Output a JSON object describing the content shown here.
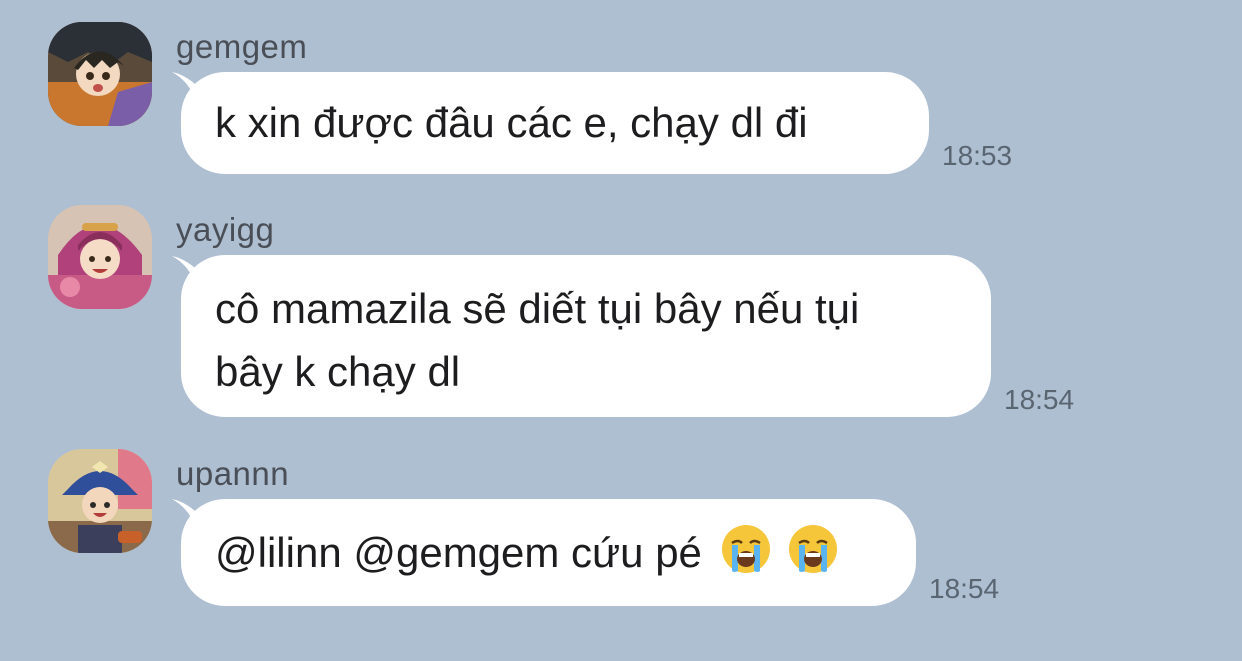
{
  "chat": {
    "messages": [
      {
        "sender": "gemgem",
        "text": "k xin được đâu các e, chạy dl đi",
        "time": "18:53",
        "avatar": "anime-avatar-dark-hair-orange-jacket"
      },
      {
        "sender": "yayigg",
        "lines": [
          "cô mamazila sẽ diết tụi bây nếu tụi",
          "bây k chạy dl"
        ],
        "time": "18:54",
        "avatar": "anime-avatar-pink-hood"
      },
      {
        "sender": "upannn",
        "text": "@lilinn @gemgem cứu pé",
        "emojis": [
          "loudly-crying-face",
          "loudly-crying-face"
        ],
        "time": "18:54",
        "avatar": "anime-avatar-blue-cap"
      }
    ]
  },
  "colors": {
    "background": "#aebfd2",
    "bubble": "#ffffff",
    "sender_name": "#4a4f57",
    "timestamp": "#5a6572"
  }
}
